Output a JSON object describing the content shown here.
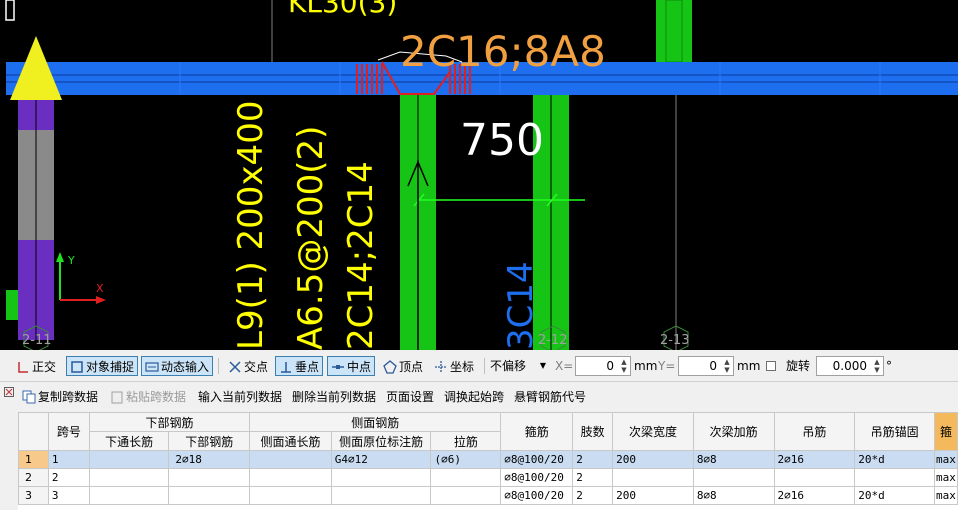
{
  "canvas": {
    "beam_name": "KL30(3)",
    "beam_rebar": "2C16;8A8",
    "dimension": "750",
    "vertical_lines": [
      "L9(1) 200x400",
      "A6.5@200(2)",
      "2C14;2C14",
      "3C14"
    ],
    "axis_labels": [
      "2-11",
      "2-12",
      "2-13"
    ],
    "ucs_x": "X",
    "ucs_y": "Y",
    "colors": {
      "background": "#000000",
      "beam_band": "#1e6ff0",
      "green_member": "#16c416",
      "text_yellow": "#ffff00",
      "text_orange": "#f0a040",
      "text_blue": "#1e6ff0",
      "rebar_red": "#e02020",
      "column_purple": "#6a2fc0"
    }
  },
  "snap_toolbar": {
    "ortho": "正交",
    "object_snap": "对象捕捉",
    "dynamic_input": "动态输入",
    "intersection": "交点",
    "perpendicular": "垂点",
    "midpoint": "中点",
    "vertex": "顶点",
    "coordinate": "坐标",
    "offset_select": "不偏移",
    "x_label": "X=",
    "x_value": "0",
    "mm1": "mm",
    "y_label": "Y=",
    "y_value": "0",
    "mm2": "mm",
    "rotate": "旋转",
    "rotate_value": "0.000",
    "degree": "°"
  },
  "table_toolbar": {
    "copy": "复制跨数据",
    "paste": "粘贴跨数据",
    "input_col": "输入当前列数据",
    "delete_col": "删除当前列数据",
    "page_setup": "页面设置",
    "swap_start": "调换起始跨",
    "cantilever": "悬臂钢筋代号"
  },
  "table": {
    "headers": {
      "span_no": "跨号",
      "bottom_group": "下部钢筋",
      "bottom_through": "下通长筋",
      "bottom_rebar": "下部钢筋",
      "side_group": "侧面钢筋",
      "side_through": "侧面通长筋",
      "side_original": "侧面原位标注筋",
      "tie": "拉筋",
      "stirrup": "箍筋",
      "legs": "肢数",
      "sec_beam_width": "次梁宽度",
      "sec_beam_add": "次梁加筋",
      "hanger": "吊筋",
      "hanger_anchor": "吊筋锚固",
      "stirrup2": "箍"
    },
    "rows": [
      {
        "num": "1",
        "span": "1",
        "bottom_through": "",
        "bottom_rebar": "2⌀18",
        "side_through": "",
        "side_original": "G4⌀12",
        "tie": "(⌀6)",
        "stirrup": "⌀8@100/20",
        "legs": "2",
        "sec_width": "200",
        "sec_add": "8⌀8",
        "hanger": "2⌀16",
        "anchor": "20*d",
        "extra": "max"
      },
      {
        "num": "2",
        "span": "2",
        "bottom_through": "",
        "bottom_rebar": "",
        "side_through": "",
        "side_original": "",
        "tie": "",
        "stirrup": "⌀8@100/20",
        "legs": "2",
        "sec_width": "",
        "sec_add": "",
        "hanger": "",
        "anchor": "",
        "extra": "max"
      },
      {
        "num": "3",
        "span": "3",
        "bottom_through": "",
        "bottom_rebar": "",
        "side_through": "",
        "side_original": "",
        "tie": "",
        "stirrup": "⌀8@100/20",
        "legs": "2",
        "sec_width": "200",
        "sec_add": "8⌀8",
        "hanger": "2⌀16",
        "anchor": "20*d",
        "extra": "max"
      }
    ]
  }
}
